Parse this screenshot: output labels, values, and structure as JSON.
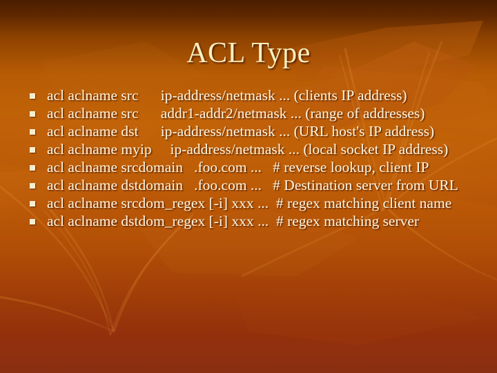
{
  "slide": {
    "title": "ACL Type",
    "background": {
      "top_color": "#4a1e00",
      "mid_color": "#c26307",
      "bottom_color": "#8a2f12",
      "art": "leaf-vein-pattern"
    },
    "text_color": "#fdf6e0",
    "title_color": "#fbf0c2",
    "bullet_color": "#f7edcf"
  },
  "bullets": [
    {
      "directive": "acl aclname src",
      "value": "ip-address/netmask ... (clients IP address)",
      "full": "acl aclname src\t ip-address/netmask ... (clients IP address)"
    },
    {
      "directive": "acl aclname src",
      "value": "addr1-addr2/netmask ... (range of addresses)",
      "full": "acl aclname src\t addr1-addr2/netmask ... (range of addresses)"
    },
    {
      "directive": "acl aclname dst",
      "value": "ip-address/netmask ... (URL host's IP address)",
      "full": "acl aclname dst\t ip-address/netmask ... (URL host's IP address)"
    },
    {
      "directive": "acl aclname myip",
      "value": "ip-address/netmask ... (local socket IP address)",
      "full": "acl aclname myip\t ip-address/netmask ... (local socket IP address)"
    },
    {
      "directive": "acl aclname srcdomain",
      "value": ".foo.com ...",
      "comment": "# reverse lookup, client IP",
      "full": "acl aclname srcdomain\t.foo.com ...\t# reverse lookup, client IP"
    },
    {
      "directive": "acl aclname dstdomain",
      "value": ".foo.com ...",
      "comment": "# Destination server from URL",
      "full": "acl aclname dstdomain\t.foo.com ...\t# Destination server from URL"
    },
    {
      "directive": "acl aclname srcdom_regex",
      "value": "[-i] xxx ...",
      "comment": "# regex matching client name",
      "full": "acl aclname srcdom_regex [-i] xxx ...\t# regex matching client name"
    },
    {
      "directive": "acl aclname dstdom_regex",
      "value": "[-i] xxx ...",
      "comment": "# regex matching server",
      "full": "acl aclname dstdom_regex [-i] xxx ...\t# regex matching server"
    }
  ],
  "bullet_lines": [
    "acl aclname src      ip-address/netmask ... (clients IP address)",
    "acl aclname src      addr1-addr2/netmask ... (range of addresses)",
    "acl aclname dst      ip-address/netmask ... (URL host's IP address)",
    "acl aclname myip     ip-address/netmask ... (local socket IP address)",
    "acl aclname srcdomain   .foo.com ...   # reverse lookup, client IP",
    "acl aclname dstdomain   .foo.com ...   # Destination server from URL",
    "acl aclname srcdom_regex [-i] xxx ...  # regex matching client name",
    "acl aclname dstdom_regex [-i] xxx ...  # regex matching server"
  ]
}
